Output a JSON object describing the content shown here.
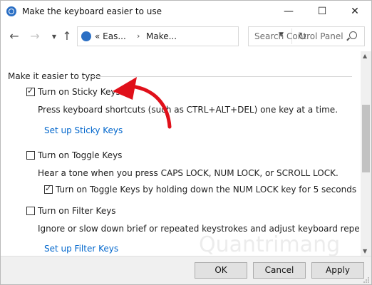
{
  "window": {
    "title": "Make the keyboard easier to use",
    "controls": {
      "minimize": "—",
      "maximize": "☐",
      "close": "✕"
    }
  },
  "nav": {
    "back_icon": "arrow-left-icon",
    "forward_icon": "arrow-right-icon",
    "recent_icon": "chevron-down-icon",
    "up_icon": "arrow-up-icon",
    "breadcrumb_1": "« Eas...",
    "breadcrumb_2": "Make...",
    "refresh_icon": "refresh-icon"
  },
  "search": {
    "placeholder": "Search Control Panel"
  },
  "section": {
    "heading": "Make it easier to type"
  },
  "options": {
    "sticky": {
      "label": "Turn on Sticky Keys",
      "checked": true,
      "description": "Press keyboard shortcuts (such as CTRL+ALT+DEL) one key at a time.",
      "link": "Set up Sticky Keys"
    },
    "toggle": {
      "label": "Turn on Toggle Keys",
      "checked": false,
      "description": "Hear a tone when you press CAPS LOCK, NUM LOCK, or SCROLL LOCK.",
      "sub_label": "Turn on Toggle Keys by holding down the NUM LOCK key for 5 seconds",
      "sub_checked": true
    },
    "filter": {
      "label": "Turn on Filter Keys",
      "checked": false,
      "description": "Ignore or slow down brief or repeated keystrokes and adjust keyboard repeat rates.",
      "link": "Set up Filter Keys"
    }
  },
  "buttons": {
    "ok": "OK",
    "cancel": "Cancel",
    "apply": "Apply"
  },
  "watermark": "Quantrimang",
  "colors": {
    "link": "#0066cc",
    "annotation_arrow": "#e0101a",
    "accent": "#2b6fc4"
  }
}
